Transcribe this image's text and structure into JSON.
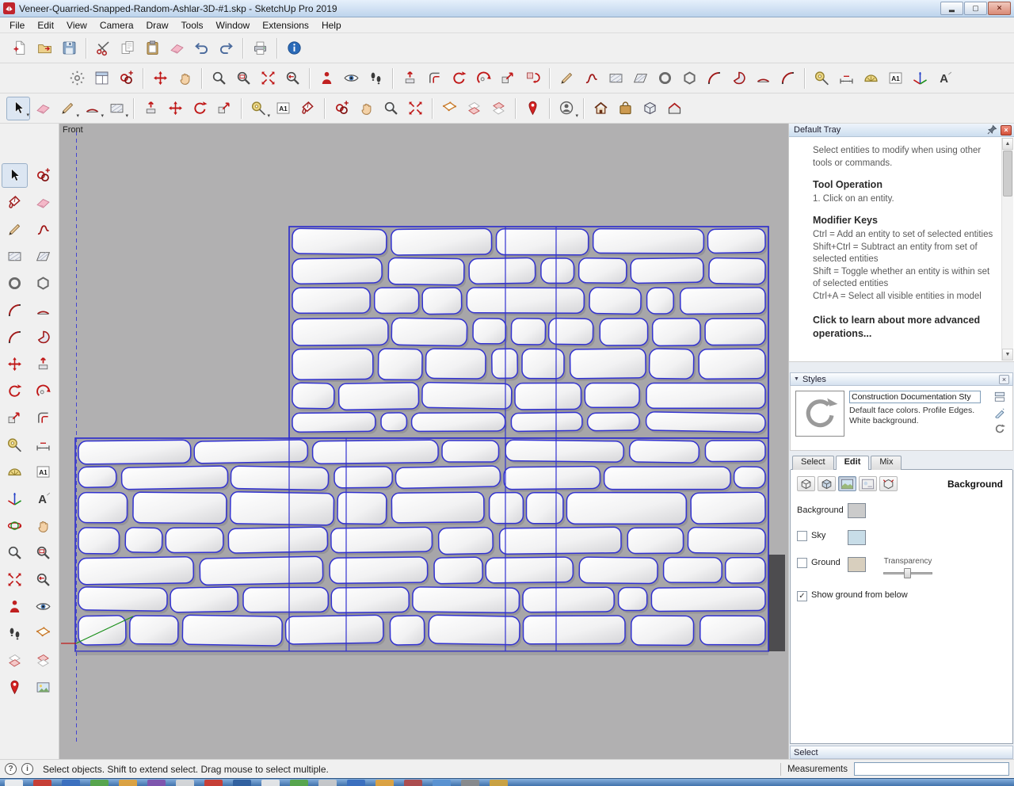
{
  "window": {
    "title": "Veneer-Quarried-Snapped-Random-Ashlar-3D-#1.skp - SketchUp Pro 2019"
  },
  "menu": {
    "items": [
      "File",
      "Edit",
      "View",
      "Camera",
      "Draw",
      "Tools",
      "Window",
      "Extensions",
      "Help"
    ]
  },
  "toolbars": {
    "standard": [
      "new-file",
      "open-file",
      "save",
      "|",
      "cut",
      "copy",
      "paste",
      "erase",
      "undo",
      "redo",
      "|",
      "print",
      "|",
      "model-info"
    ],
    "row2": [
      "style-settings",
      "tray-toggle",
      "components-browser",
      "|",
      "move",
      "pan",
      "|",
      "zoom",
      "zoom-window",
      "zoom-extents",
      "zoom-previous",
      "|",
      "position-camera",
      "look-around",
      "walk",
      "|",
      "push-pull",
      "offset",
      "rotate",
      "follow-me",
      "scale",
      "flip",
      "|",
      "line",
      "freehand",
      "rectangle",
      "rotated-rectangle",
      "circle",
      "polygon",
      "arc",
      "pie",
      "2-point-arc",
      "3-point-arc",
      "|",
      "tape-measure",
      "dimension",
      "protractor",
      "text",
      "axes",
      "3d-text"
    ],
    "row3": [
      "select-menu",
      "eraser",
      "line-menu",
      "arcs-menu",
      "shapes-menu",
      "|",
      "push-pull",
      "move",
      "rotate",
      "scale",
      "|",
      "tape-menu",
      "text",
      "paint-bucket",
      "|",
      "make-component",
      "pan",
      "zoom",
      "zoom-extents",
      "|",
      "section-plane",
      "section-display",
      "section-fill",
      "|",
      "add-location",
      "|",
      "sign-in-menu",
      "|",
      "3d-warehouse",
      "extension-warehouse",
      "trimble-connect",
      "shop"
    ],
    "left": [
      "select",
      "make-component",
      "paint-bucket",
      "eraser",
      "line",
      "freehand",
      "rectangle",
      "rotated-rectangle",
      "circle",
      "polygon",
      "arc",
      "2-point-arc",
      "3-point-arc",
      "pie",
      "move",
      "push-pull",
      "rotate",
      "follow-me",
      "scale",
      "offset",
      "tape-measure",
      "dimension",
      "protractor",
      "text",
      "axes",
      "3d-text",
      "orbit",
      "pan",
      "zoom",
      "zoom-window",
      "zoom-extents",
      "zoom-previous",
      "position-camera",
      "look-around",
      "walk",
      "section-plane",
      "section-display",
      "section-fill",
      "add-location",
      "match-photo"
    ]
  },
  "viewport": {
    "scene_label": "Front"
  },
  "tray": {
    "title": "Default Tray",
    "instructor": {
      "intro": "Select entities to modify when using other tools or commands.",
      "tool_operation_title": "Tool Operation",
      "tool_operation_step": "1. Click on an entity.",
      "modifier_keys_title": "Modifier Keys",
      "modifier_lines": [
        "Ctrl = Add an entity to set of selected entities",
        "Shift+Ctrl = Subtract an entity from set of selected entities",
        "Shift = Toggle whether an entity is within set of selected entities",
        "Ctrl+A = Select all visible entities in model"
      ],
      "more_link": "Click to learn about more advanced operations..."
    },
    "styles": {
      "title": "Styles",
      "name": "Construction Documentation Sty",
      "description": "Default face colors. Profile Edges. White background.",
      "tabs": [
        "Select",
        "Edit",
        "Mix"
      ],
      "active_tab": "Edit",
      "section_label": "Background",
      "background_label": "Background",
      "sky_label": "Sky",
      "ground_label": "Ground",
      "transparency_label": "Transparency",
      "show_ground_label": "Show ground from below"
    },
    "bottom_panel": "Select"
  },
  "statusbar": {
    "hint": "Select objects. Shift to extend select. Drag mouse to select multiple.",
    "measurements_label": "Measurements",
    "measurements_value": ""
  },
  "taskbar": {
    "app_count": 18
  },
  "colors": {
    "selection_blue": "#3232d0",
    "viewport_gray": "#b1b0b1",
    "sky_swatch": "#c8dde8",
    "ground_swatch": "#d8cfbe",
    "background_swatch": "#cbcbcb"
  }
}
